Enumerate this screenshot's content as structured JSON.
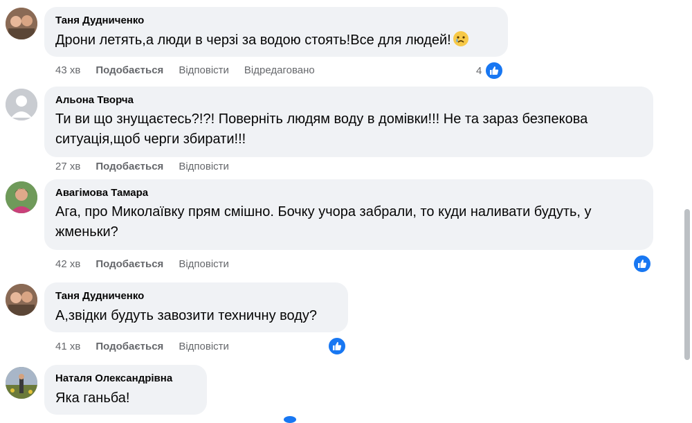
{
  "colors": {
    "like_blue": "#1877f2",
    "bubble_bg": "#f0f2f5",
    "meta_gray": "#65676b"
  },
  "comments": [
    {
      "author": "Таня Дудниченко",
      "text": "Дрони летять,а люди в черзі за водою стоять!Все для людей!",
      "emoji": "crying-face-icon",
      "time": "43 хв",
      "like_label": "Подобається",
      "reply_label": "Відповісти",
      "edited_label": "Відредаговано",
      "reaction_count": "4",
      "reaction_icon": "like-icon"
    },
    {
      "author": "Альона Творча",
      "text_lines": [
        "Ти ви що знущаєтесь?!?! Поверніть людям воду в домівки!!! Не та зараз безпекова",
        "ситуація,щоб черги збирати!!!"
      ],
      "time": "27 хв",
      "like_label": "Подобається",
      "reply_label": "Відповісти"
    },
    {
      "author": "Авагімова Тамара",
      "text_lines": [
        "Ага, про Миколаївку прям смішно. Бочку учора забрали, то куди наливати будуть, у",
        "жменьки?"
      ],
      "time": "42 хв",
      "like_label": "Подобається",
      "reply_label": "Відповісти",
      "reaction_icon": "like-icon"
    },
    {
      "author": "Таня Дудниченко",
      "text": "А,звідки будуть завозити техничну воду?",
      "time": "41 хв",
      "like_label": "Подобається",
      "reply_label": "Відповісти",
      "reaction_icon": "like-icon"
    },
    {
      "author": "Наталя Олександрівна",
      "text": "Яка ганьба!"
    }
  ]
}
